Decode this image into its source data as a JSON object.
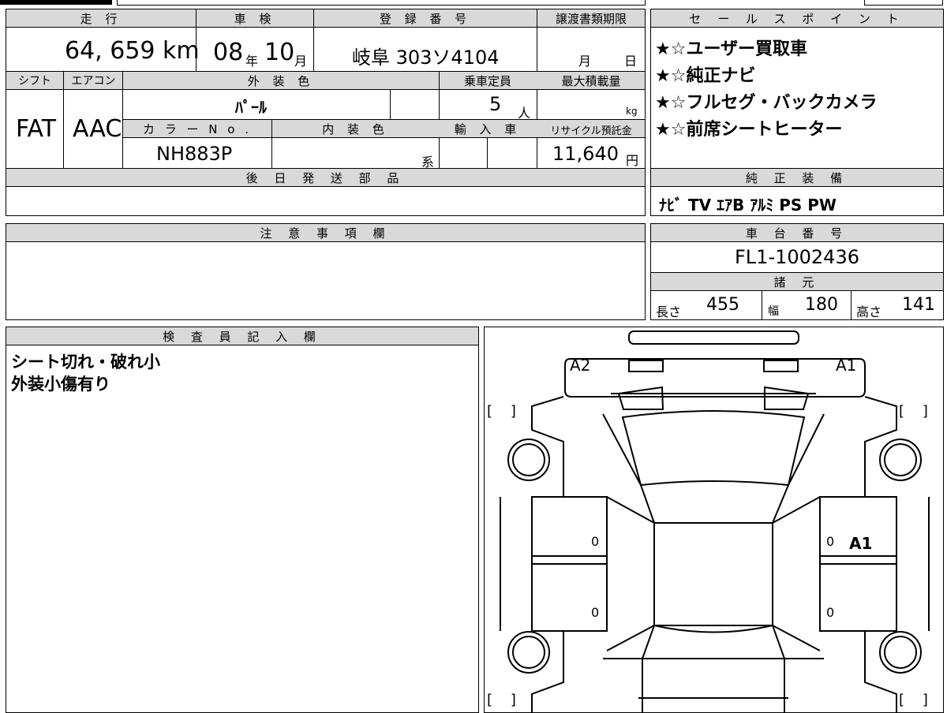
{
  "headers": {
    "mileage": "走 行",
    "inspection": "車 検",
    "registration": "登 録 番 号",
    "transfer_deadline": "譲渡書類期限",
    "shift": "シフト",
    "aircon": "エアコン",
    "exterior_color": "外 装 色",
    "capacity": "乗車定員",
    "max_load": "最大積載量",
    "color_no": "カ ラ ー N o .",
    "interior_color": "内 装 色",
    "import": "輸 入 車",
    "recycle": "リサイクル預託金",
    "later_parts": "後 日 発 送 部 品",
    "notes": "注 意 事 項 欄",
    "inspector": "検 査 員 記 入 欄",
    "sales_points": "セ ー ル ス ポ イ ン ト",
    "equipment": "純 正 装 備",
    "chassis": "車 台 番 号",
    "specs": "諸 元"
  },
  "vehicle": {
    "mileage_value": "64, 659",
    "mileage_unit": "km",
    "inspection_year": "08",
    "year_unit": "年",
    "inspection_month": "10",
    "month_unit": "月",
    "registration_number": "岐阜 303ソ4104",
    "deadline_month_unit": "月",
    "deadline_day_unit": "日",
    "shift_value": "FAT",
    "aircon_value": "AAC",
    "exterior_color_value": "ﾊﾟｰﾙ",
    "capacity_value": "5",
    "capacity_unit": "人",
    "load_unit": "kg",
    "color_no_value": "NH883P",
    "interior_suffix": "系",
    "recycle_value": "11,640",
    "recycle_unit": "円"
  },
  "sales_points": [
    "★☆ユーザー買取車",
    "★☆純正ナビ",
    "★☆フルセグ・バックカメラ",
    "★☆前席シートヒーター"
  ],
  "equipment_value": "ﾅﾋﾞ TV ｴｱB ｱﾙﾐ PS PW",
  "chassis_value": "FL1-1002436",
  "specs": {
    "length_label": "長さ",
    "length_value": "455",
    "width_label": "幅",
    "width_value": "180",
    "height_label": "高さ",
    "height_value": "141"
  },
  "inspector_notes": [
    "シート切れ・破れ小",
    "外装小傷有り"
  ],
  "diagram": {
    "label_a2": "A2",
    "label_a1_top": "A1",
    "label_a1_side": "A1",
    "zero_left_1": "0",
    "zero_left_2": "0",
    "zero_right_1": "0",
    "zero_right_2": "0",
    "bracket_l1": "[    ]",
    "bracket_r1": "[    ]",
    "bracket_l2": "[    ]",
    "bracket_r2": "[    ]"
  }
}
